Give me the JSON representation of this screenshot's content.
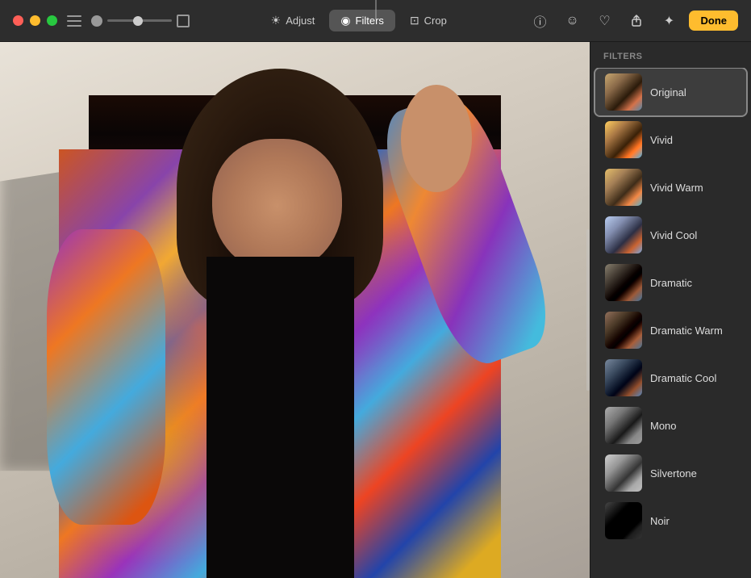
{
  "titlebar": {
    "traffic_lights": {
      "close": "close",
      "minimize": "minimize",
      "maximize": "maximize"
    },
    "tabs": [
      {
        "id": "adjust",
        "label": "Adjust",
        "icon": "☀",
        "active": false
      },
      {
        "id": "filters",
        "label": "Filters",
        "icon": "◉",
        "active": true
      },
      {
        "id": "crop",
        "label": "Crop",
        "icon": "⊡",
        "active": false
      }
    ],
    "right_icons": [
      {
        "id": "info",
        "icon": "ⓘ"
      },
      {
        "id": "emoji",
        "icon": "☺"
      },
      {
        "id": "heart",
        "icon": "♡"
      },
      {
        "id": "share",
        "icon": "⬡"
      },
      {
        "id": "tools",
        "icon": "✦"
      }
    ],
    "done_label": "Done"
  },
  "sidebar": {
    "header": "Filters",
    "filters": [
      {
        "id": "original",
        "label": "Original",
        "selected": true,
        "thumb_class": "thumb-original"
      },
      {
        "id": "vivid",
        "label": "Vivid",
        "selected": false,
        "thumb_class": "thumb-vivid"
      },
      {
        "id": "vivid-warm",
        "label": "Vivid Warm",
        "selected": false,
        "thumb_class": "thumb-vivid-warm"
      },
      {
        "id": "vivid-cool",
        "label": "Vivid Cool",
        "selected": false,
        "thumb_class": "thumb-vivid-cool"
      },
      {
        "id": "dramatic",
        "label": "Dramatic",
        "selected": false,
        "thumb_class": "thumb-dramatic"
      },
      {
        "id": "dramatic-warm",
        "label": "Dramatic Warm",
        "selected": false,
        "thumb_class": "thumb-dramatic-warm"
      },
      {
        "id": "dramatic-cool",
        "label": "Dramatic Cool",
        "selected": false,
        "thumb_class": "thumb-dramatic-cool"
      },
      {
        "id": "mono",
        "label": "Mono",
        "selected": false,
        "thumb_class": "thumb-mono"
      },
      {
        "id": "silvertone",
        "label": "Silvertone",
        "selected": false,
        "thumb_class": "thumb-silvertone"
      },
      {
        "id": "noir",
        "label": "Noir",
        "selected": false,
        "thumb_class": "thumb-noir"
      }
    ]
  }
}
